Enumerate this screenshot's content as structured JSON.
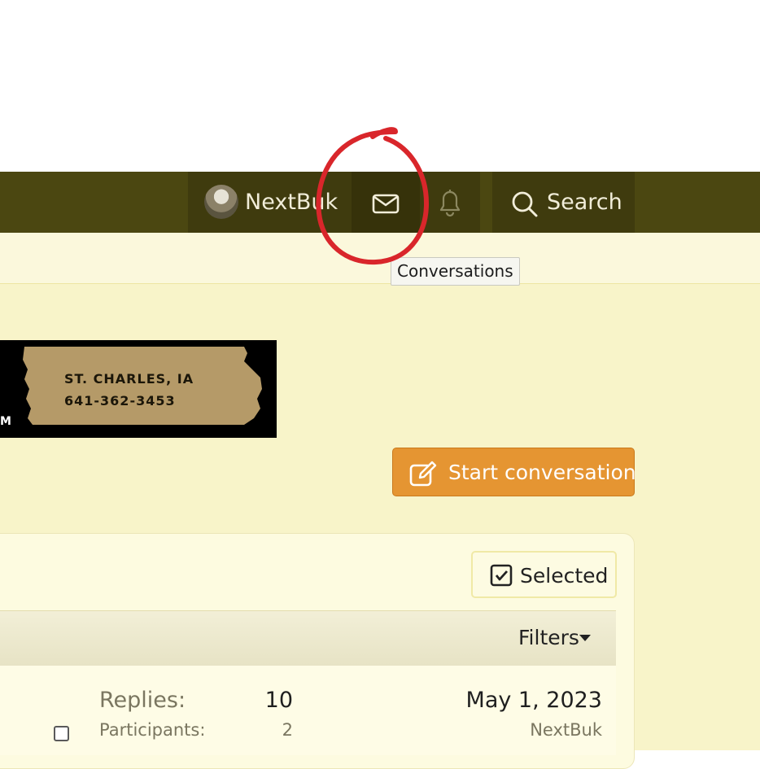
{
  "nav": {
    "username": "NextBuk",
    "search_label": "Search"
  },
  "tooltip": {
    "text": "Conversations"
  },
  "banner": {
    "location": "ST. CHARLES, IA",
    "phone": "641-362-3453",
    "fragment": "M"
  },
  "actions": {
    "start_conversation": "Start conversation",
    "selected": "Selected",
    "filters": "Filters"
  },
  "conversation_row": {
    "replies_label": "Replies:",
    "replies_value": "10",
    "participants_label": "Participants:",
    "participants_value": "2",
    "last_date": "May 1, 2023",
    "last_user": "NextBuk"
  },
  "icons": {
    "conversations": "envelope-icon",
    "alerts": "bell-icon",
    "search": "search-icon",
    "start": "edit-icon",
    "selected": "checkbox-icon",
    "filters": "caret-down-icon"
  },
  "colors": {
    "nav_bg": "#4b4711",
    "accent_button": "#e59532",
    "annotation": "#d9262b",
    "page_bg": "#f8f4c9"
  }
}
